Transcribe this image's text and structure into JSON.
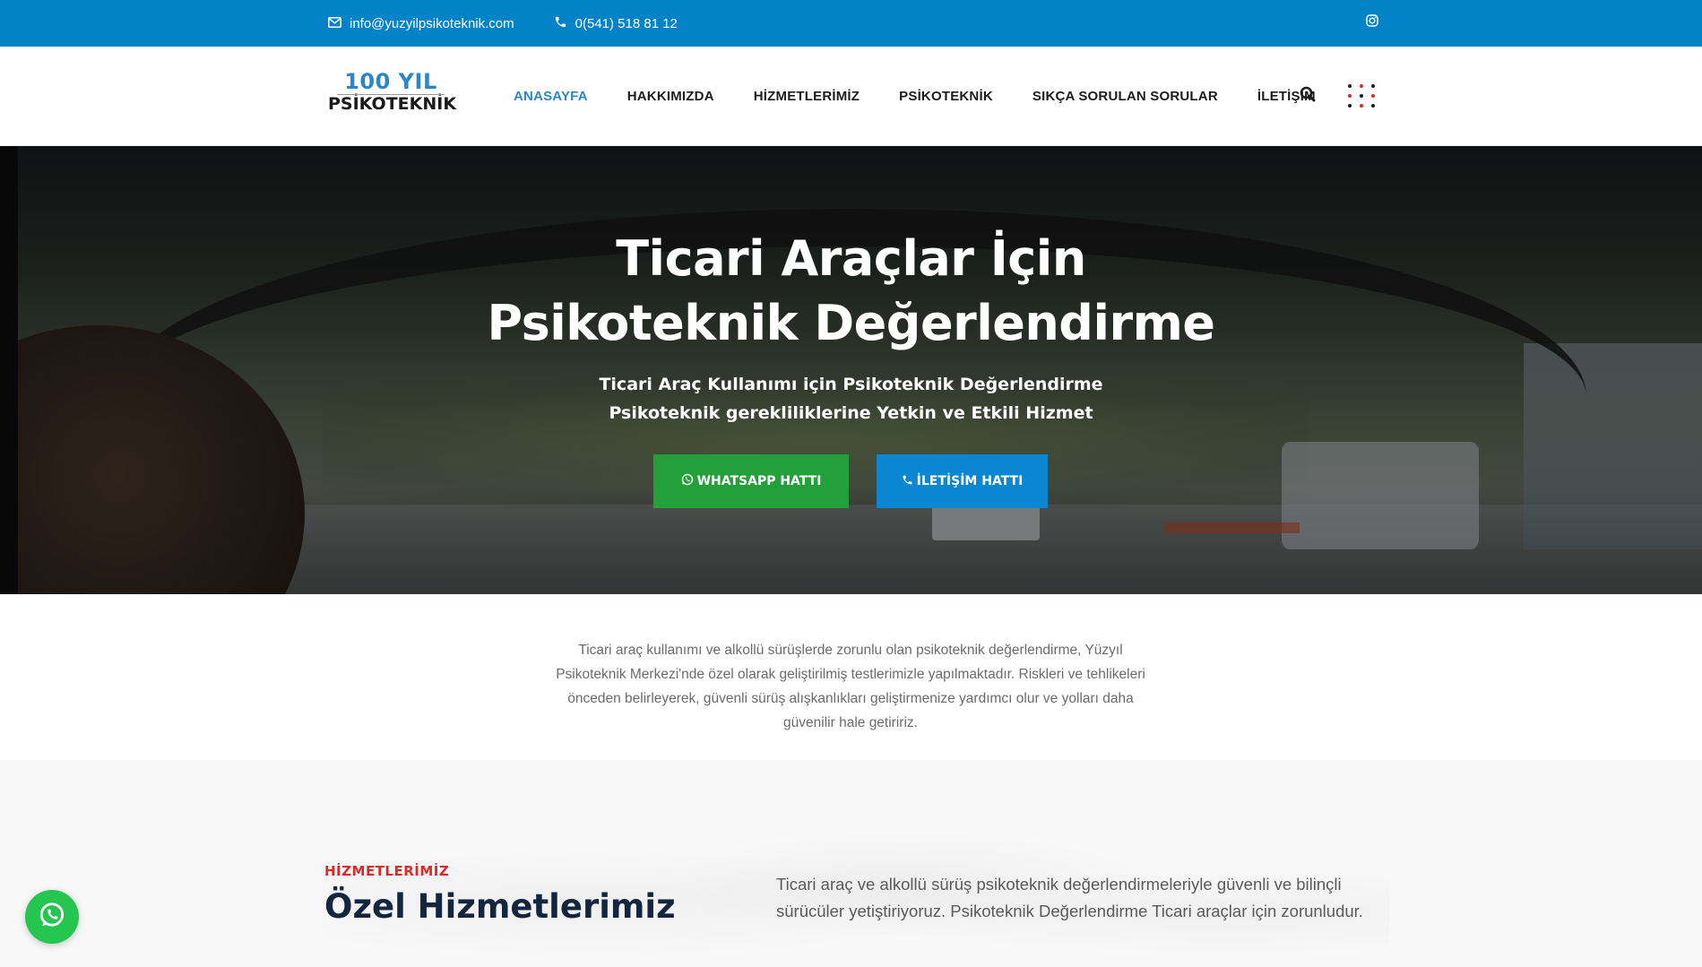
{
  "topbar": {
    "email": "info@yuzyilpsikoteknik.com",
    "phone": "0(541) 518 81 12"
  },
  "logo": {
    "line1": "100 YIL",
    "line2": "PSİKOTEKNİK"
  },
  "nav": {
    "items": [
      {
        "label": "ANASAYFA",
        "active": true
      },
      {
        "label": "HAKKIMIZDA"
      },
      {
        "label": "HİZMETLERİMİZ"
      },
      {
        "label": "PSİKOTEKNİK"
      },
      {
        "label": "SIKÇA SORULAN SORULAR"
      },
      {
        "label": "İLETİŞİM"
      }
    ]
  },
  "hero": {
    "title_line1": "Ticari Araçlar İçin",
    "title_line2": "Psikoteknik Değerlendirme",
    "subtitle_line1": "Ticari Araç Kullanımı için Psikoteknik Değerlendirme",
    "subtitle_line2": "Psikoteknik gerekliliklerine Yetkin ve Etkili Hizmet",
    "whatsapp_label": "WHATSAPP HATTI",
    "contact_label": "İLETİŞİM HATTI"
  },
  "intro": {
    "text": "Ticari araç kullanımı ve alkollü sürüşlerde zorunlu olan psikoteknik değerlendirme, Yüzyıl Psikoteknik Merkezi'nde özel olarak geliştirilmiş testlerimizle yapılmaktadır. Riskleri ve tehlikeleri önceden belirleyerek, güvenli sürüş alışkanlıkları geliştirmenize yardımcı olur ve yolları daha güvenilir hale getiririz."
  },
  "services": {
    "kicker": "HİZMETLERİMİZ",
    "title": "Özel Hizmetlerimiz",
    "description": "Ticari araç ve alkollü sürüş psikoteknik değerlendirmeleriyle güvenli ve bilinçli sürücüler yetiştiriyoruz. Psikoteknik Değerlendirme Ticari araçlar için zorunludur."
  },
  "colors": {
    "topbar": "#0283c8",
    "accent": "#2c86c6",
    "whatsapp": "#23a03a",
    "call": "#0a87d0",
    "kicker": "#d62b2b",
    "title": "#14263f"
  },
  "icons": [
    "envelope-icon",
    "phone-icon",
    "instagram-icon",
    "search-icon",
    "dots-menu-icon",
    "whatsapp-icon"
  ]
}
